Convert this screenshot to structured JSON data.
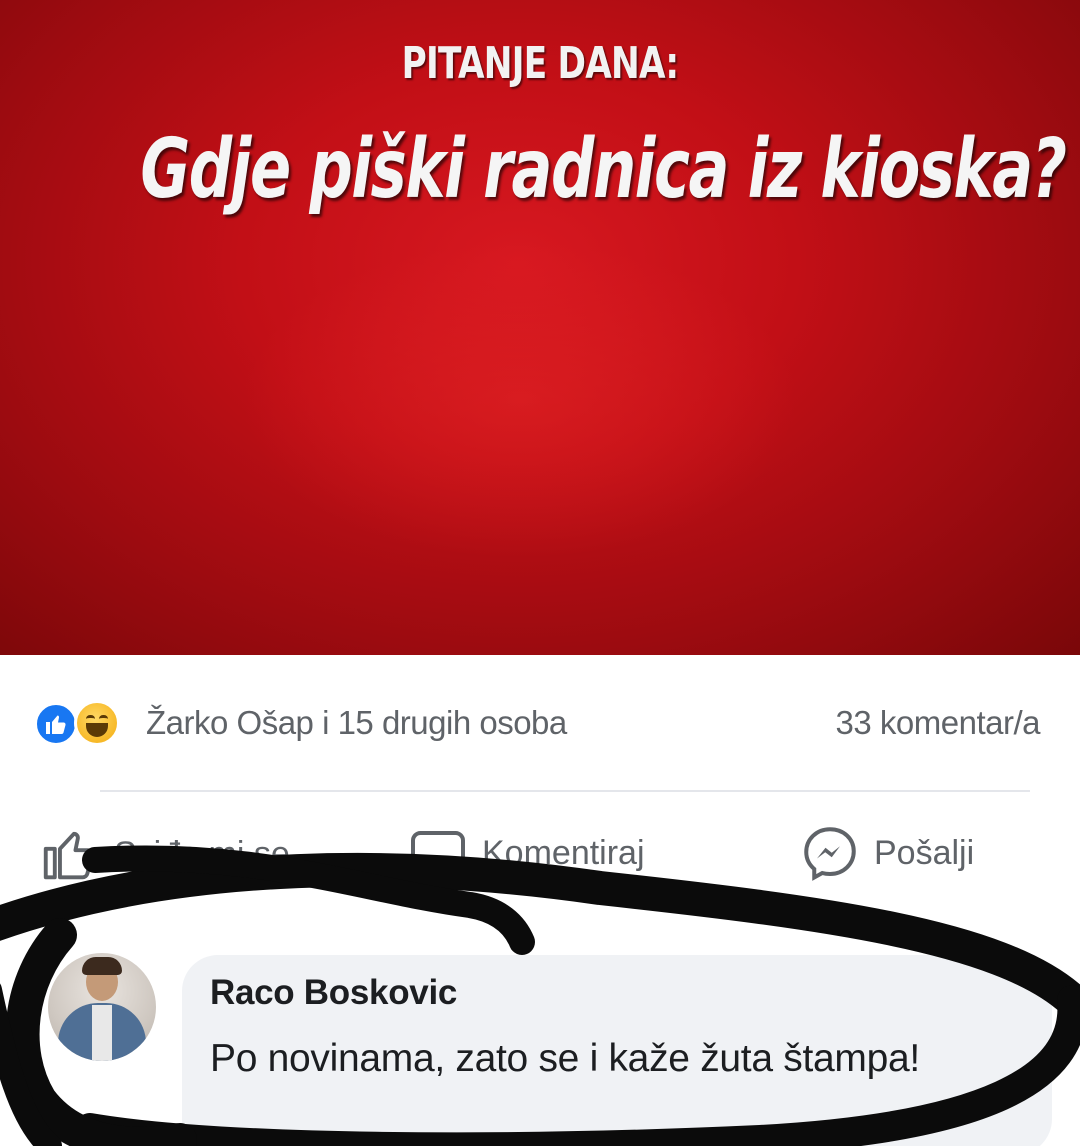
{
  "post": {
    "image": {
      "kicker": "PITANJE DANA:",
      "headline": "Gdje piški radnica iz kioska?",
      "background_color": "#c8101a"
    },
    "reactions": {
      "icons": [
        "like-reaction-icon",
        "haha-reaction-icon"
      ],
      "summary": "Žarko Ošap i 15 drugih osoba",
      "comment_count": "33 komentar/a"
    },
    "actions": [
      {
        "label": "Sviđa mi se",
        "icon": "thumbs-up-icon"
      },
      {
        "label": "Komentiraj",
        "icon": "comment-bubble-icon"
      },
      {
        "label": "Pošalji",
        "icon": "messenger-icon"
      }
    ]
  },
  "comment": {
    "author": "Raco Boskovic",
    "text": "Po novinama, zato se i kaže žuta štampa!"
  },
  "colors": {
    "accent_blue": "#1877f2",
    "haha_yellow": "#f7b928",
    "marker": "#0b0b0b",
    "secondary_text": "#5f6368"
  }
}
